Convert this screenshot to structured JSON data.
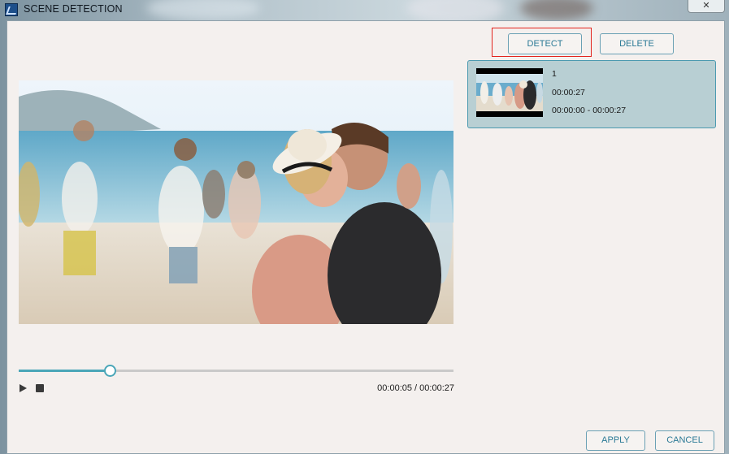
{
  "window": {
    "title": "SCENE DETECTION",
    "close_label": "✕"
  },
  "toolbar": {
    "detect_label": "DETECT",
    "delete_label": "DELETE"
  },
  "player": {
    "progress_fraction": 0.207,
    "current_time": "00:00:05",
    "total_time": "00:00:27",
    "time_separator": " / "
  },
  "scenes": [
    {
      "index": "1",
      "duration": "00:00:27",
      "range": "00:00:00 - 00:00:27"
    }
  ],
  "footer": {
    "apply_label": "APPLY",
    "cancel_label": "CANCEL"
  },
  "colors": {
    "accent": "#4aa6b8",
    "button_text": "#2c7a96",
    "selected_item_bg": "#b8cfd3",
    "focus_outline": "#e3221c",
    "dialog_bg": "#f4f0ee"
  },
  "icons": {
    "app": "app-logo-icon",
    "close": "close-icon",
    "play": "play-icon",
    "stop": "stop-icon"
  }
}
